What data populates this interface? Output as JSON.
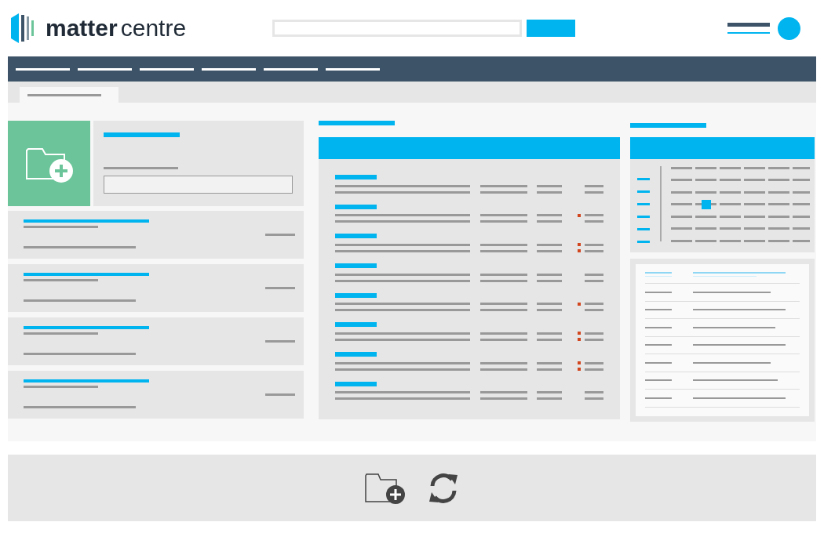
{
  "logo": {
    "brand_bold": "matter",
    "brand_light": "centre"
  },
  "matters": [
    {
      "flags": [
        false,
        false
      ]
    },
    {
      "flags": [
        true,
        false
      ]
    },
    {
      "flags": [
        true,
        true
      ]
    },
    {
      "flags": [
        false,
        false
      ]
    },
    {
      "flags": [
        true,
        false
      ]
    },
    {
      "flags": [
        true,
        true
      ]
    },
    {
      "flags": [
        true,
        true
      ]
    },
    {
      "flags": [
        false,
        false
      ]
    }
  ],
  "calendar": {
    "weeks": [
      {
        "days": [
          {
            "selected": false
          },
          {
            "selected": false
          },
          {
            "selected": false
          },
          {
            "selected": false
          },
          {
            "selected": false
          },
          {
            "selected": false
          }
        ]
      },
      {
        "days": [
          {
            "selected": false
          },
          {
            "selected": false
          },
          {
            "selected": false
          },
          {
            "selected": false
          },
          {
            "selected": false
          },
          {
            "selected": false
          }
        ]
      },
      {
        "days": [
          {
            "selected": false
          },
          {
            "selected": true
          },
          {
            "selected": false
          },
          {
            "selected": false
          },
          {
            "selected": false
          },
          {
            "selected": false
          }
        ]
      },
      {
        "days": [
          {
            "selected": false
          },
          {
            "selected": false
          },
          {
            "selected": false
          },
          {
            "selected": false
          },
          {
            "selected": false
          },
          {
            "selected": false
          }
        ]
      },
      {
        "days": [
          {
            "selected": false
          },
          {
            "selected": false
          },
          {
            "selected": false
          },
          {
            "selected": false
          },
          {
            "selected": false
          },
          {
            "selected": false
          }
        ]
      },
      {
        "days": [
          {
            "selected": false
          },
          {
            "selected": false
          },
          {
            "selected": false
          },
          {
            "selected": false
          },
          {
            "selected": false
          },
          {
            "selected": false
          }
        ]
      }
    ]
  }
}
